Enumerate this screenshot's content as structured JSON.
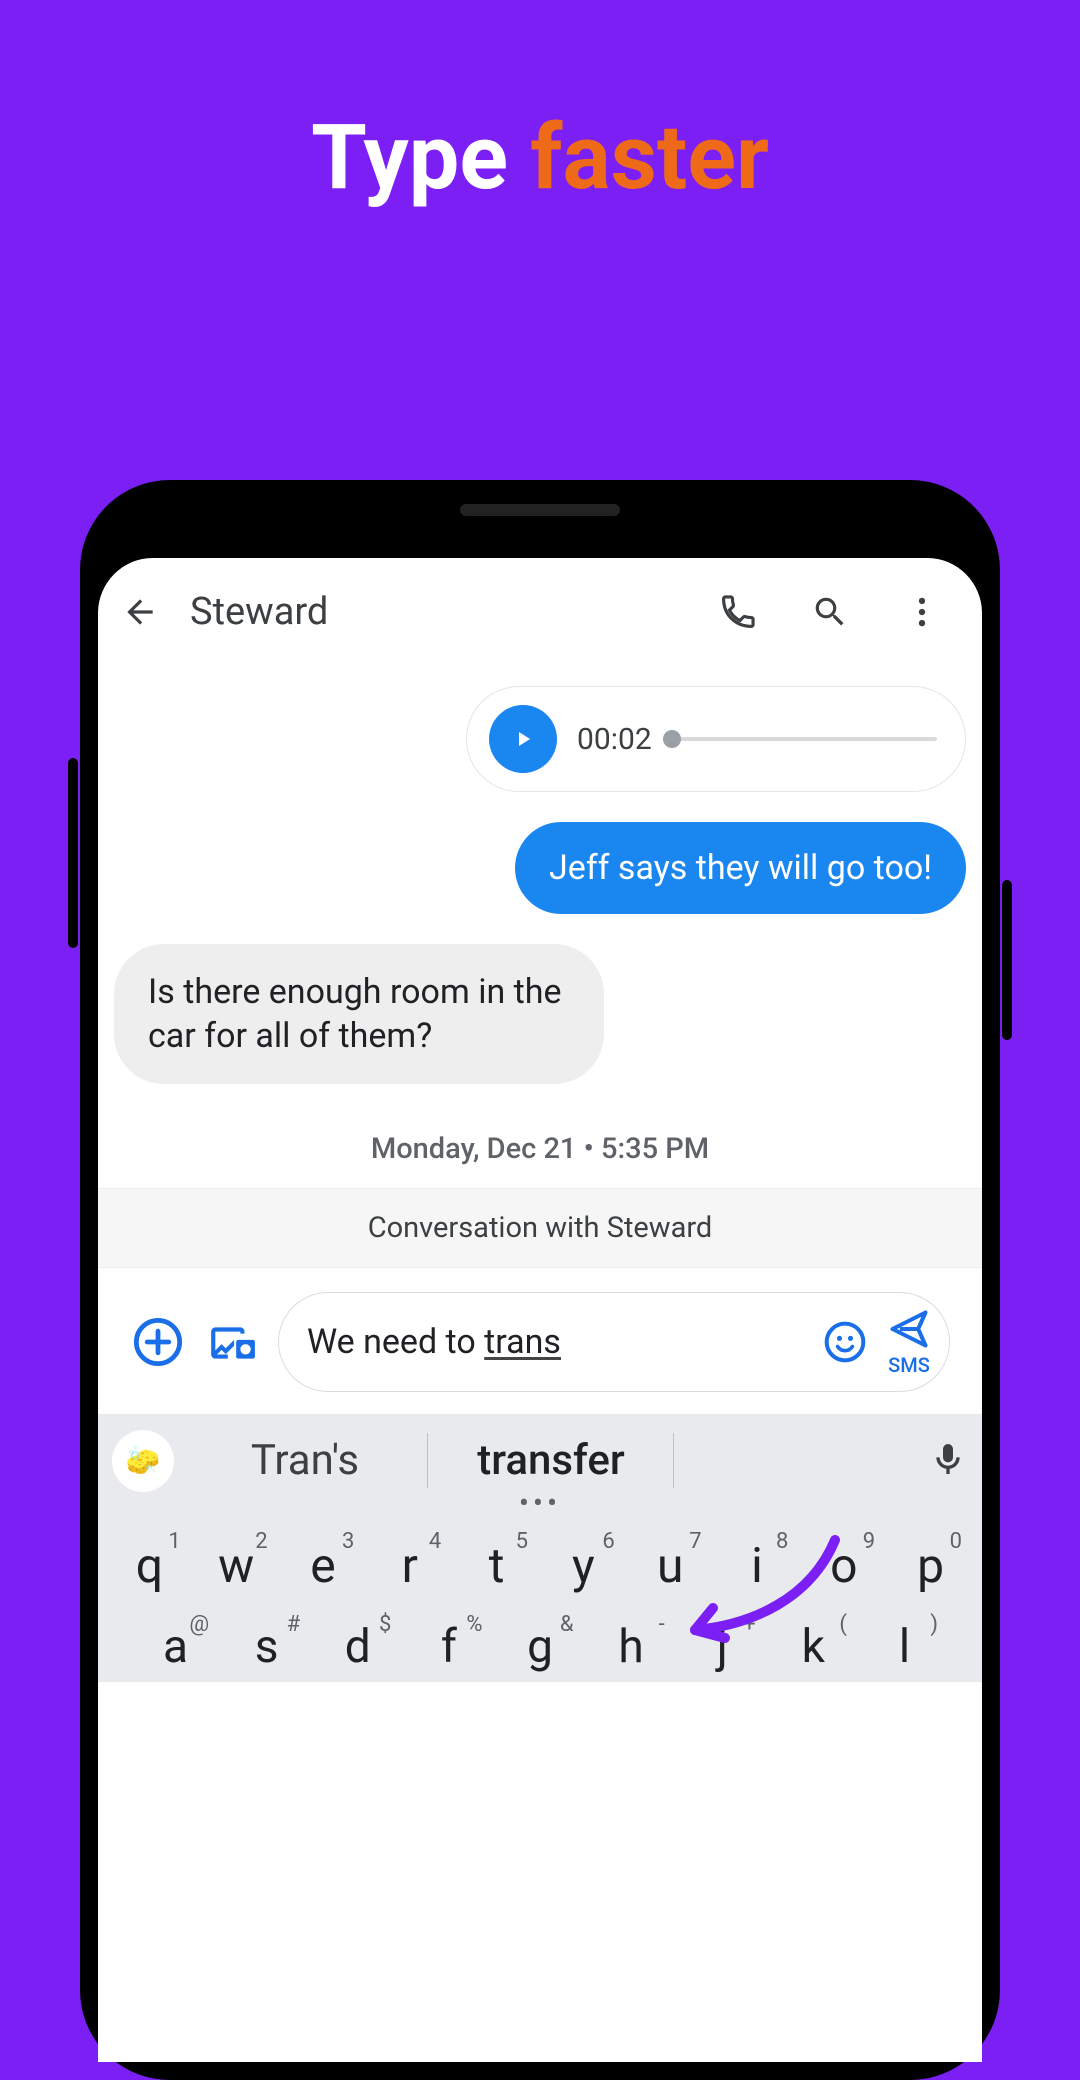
{
  "headline": {
    "word1": "Type",
    "word2": "faster"
  },
  "appbar": {
    "contact_name": "Steward"
  },
  "voice": {
    "duration": "00:02"
  },
  "messages": {
    "sent1": "Jeff says they will go too!",
    "recv1": "Is there enough room in the car for all of them?"
  },
  "meta": {
    "timestamp": "Monday, Dec 21 • 5:35 PM",
    "convo_with": "Conversation with Steward"
  },
  "compose": {
    "text_prefix": "We need to ",
    "text_underlined": "trans",
    "send_label": "SMS"
  },
  "suggestions": {
    "s1": "Tran's",
    "s2": "transfer"
  },
  "keyboard": {
    "row1": [
      {
        "main": "q",
        "hint": "1"
      },
      {
        "main": "w",
        "hint": "2"
      },
      {
        "main": "e",
        "hint": "3"
      },
      {
        "main": "r",
        "hint": "4"
      },
      {
        "main": "t",
        "hint": "5"
      },
      {
        "main": "y",
        "hint": "6"
      },
      {
        "main": "u",
        "hint": "7"
      },
      {
        "main": "i",
        "hint": "8"
      },
      {
        "main": "o",
        "hint": "9"
      },
      {
        "main": "p",
        "hint": "0"
      }
    ],
    "row2": [
      {
        "main": "a",
        "hint": "@"
      },
      {
        "main": "s",
        "hint": "#"
      },
      {
        "main": "d",
        "hint": "$"
      },
      {
        "main": "f",
        "hint": "%"
      },
      {
        "main": "g",
        "hint": "&"
      },
      {
        "main": "h",
        "hint": "-"
      },
      {
        "main": "j",
        "hint": "+"
      },
      {
        "main": "k",
        "hint": "("
      },
      {
        "main": "l",
        "hint": ")"
      }
    ]
  }
}
